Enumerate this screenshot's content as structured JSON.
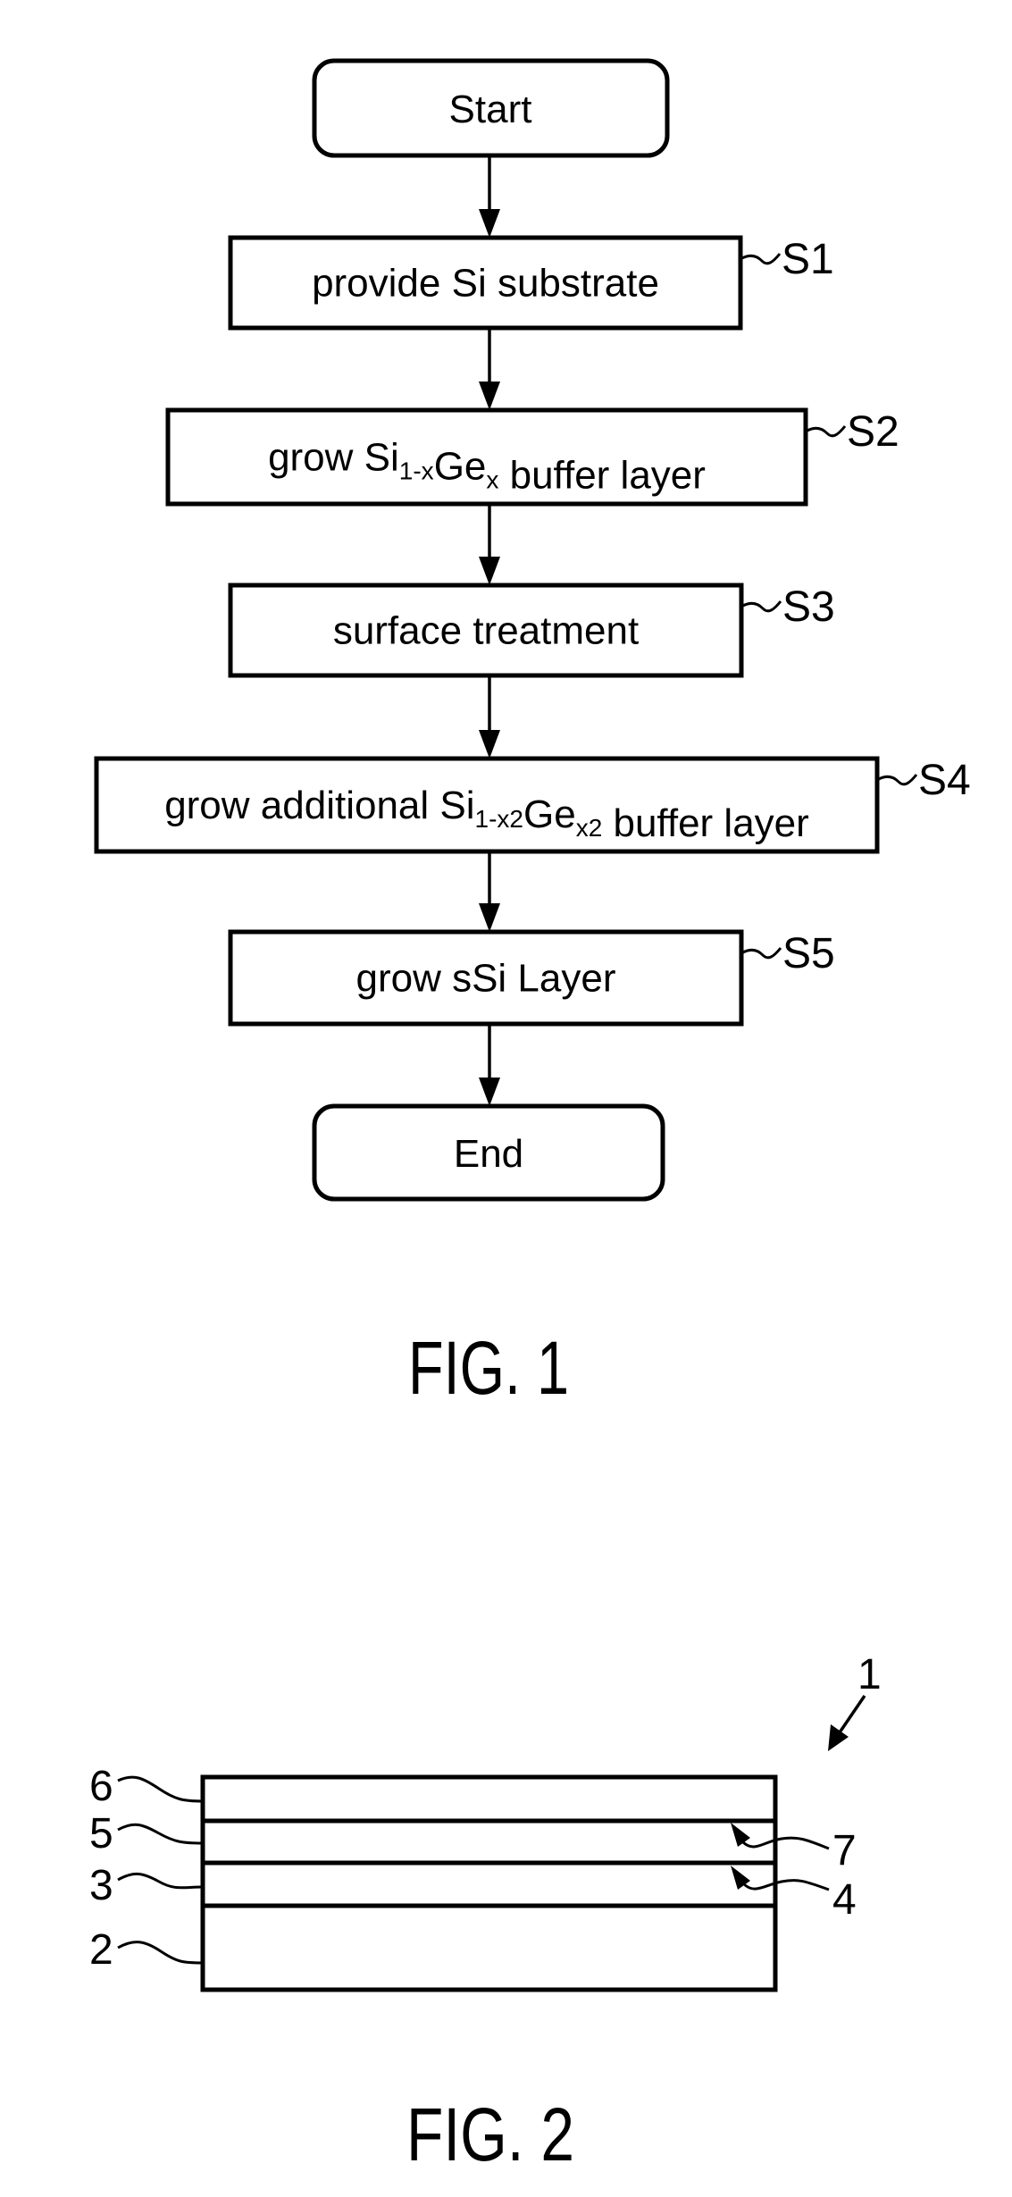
{
  "fig1": {
    "caption": "FIG. 1",
    "start_label": "Start",
    "end_label": "End",
    "steps": [
      {
        "id": "S1",
        "parts": [
          {
            "t": "provide Si substrate"
          }
        ]
      },
      {
        "id": "S2",
        "parts": [
          {
            "t": "grow Si"
          },
          {
            "t": "1-x",
            "sub": true
          },
          {
            "t": "Ge"
          },
          {
            "t": "x",
            "sub": true
          },
          {
            "t": " buffer layer"
          }
        ]
      },
      {
        "id": "S3",
        "parts": [
          {
            "t": "surface treatment"
          }
        ]
      },
      {
        "id": "S4",
        "parts": [
          {
            "t": "grow additional Si"
          },
          {
            "t": "1-x2",
            "sub": true
          },
          {
            "t": "Ge"
          },
          {
            "t": "x2",
            "sub": true
          },
          {
            "t": " buffer layer"
          }
        ]
      },
      {
        "id": "S5",
        "parts": [
          {
            "t": "grow sSi Layer"
          }
        ]
      }
    ]
  },
  "fig2": {
    "caption": "FIG. 2",
    "device_ref": "1",
    "layer_refs_top_to_bottom": [
      "6",
      "5",
      "3",
      "2"
    ],
    "interface_refs": [
      "7",
      "4"
    ]
  }
}
